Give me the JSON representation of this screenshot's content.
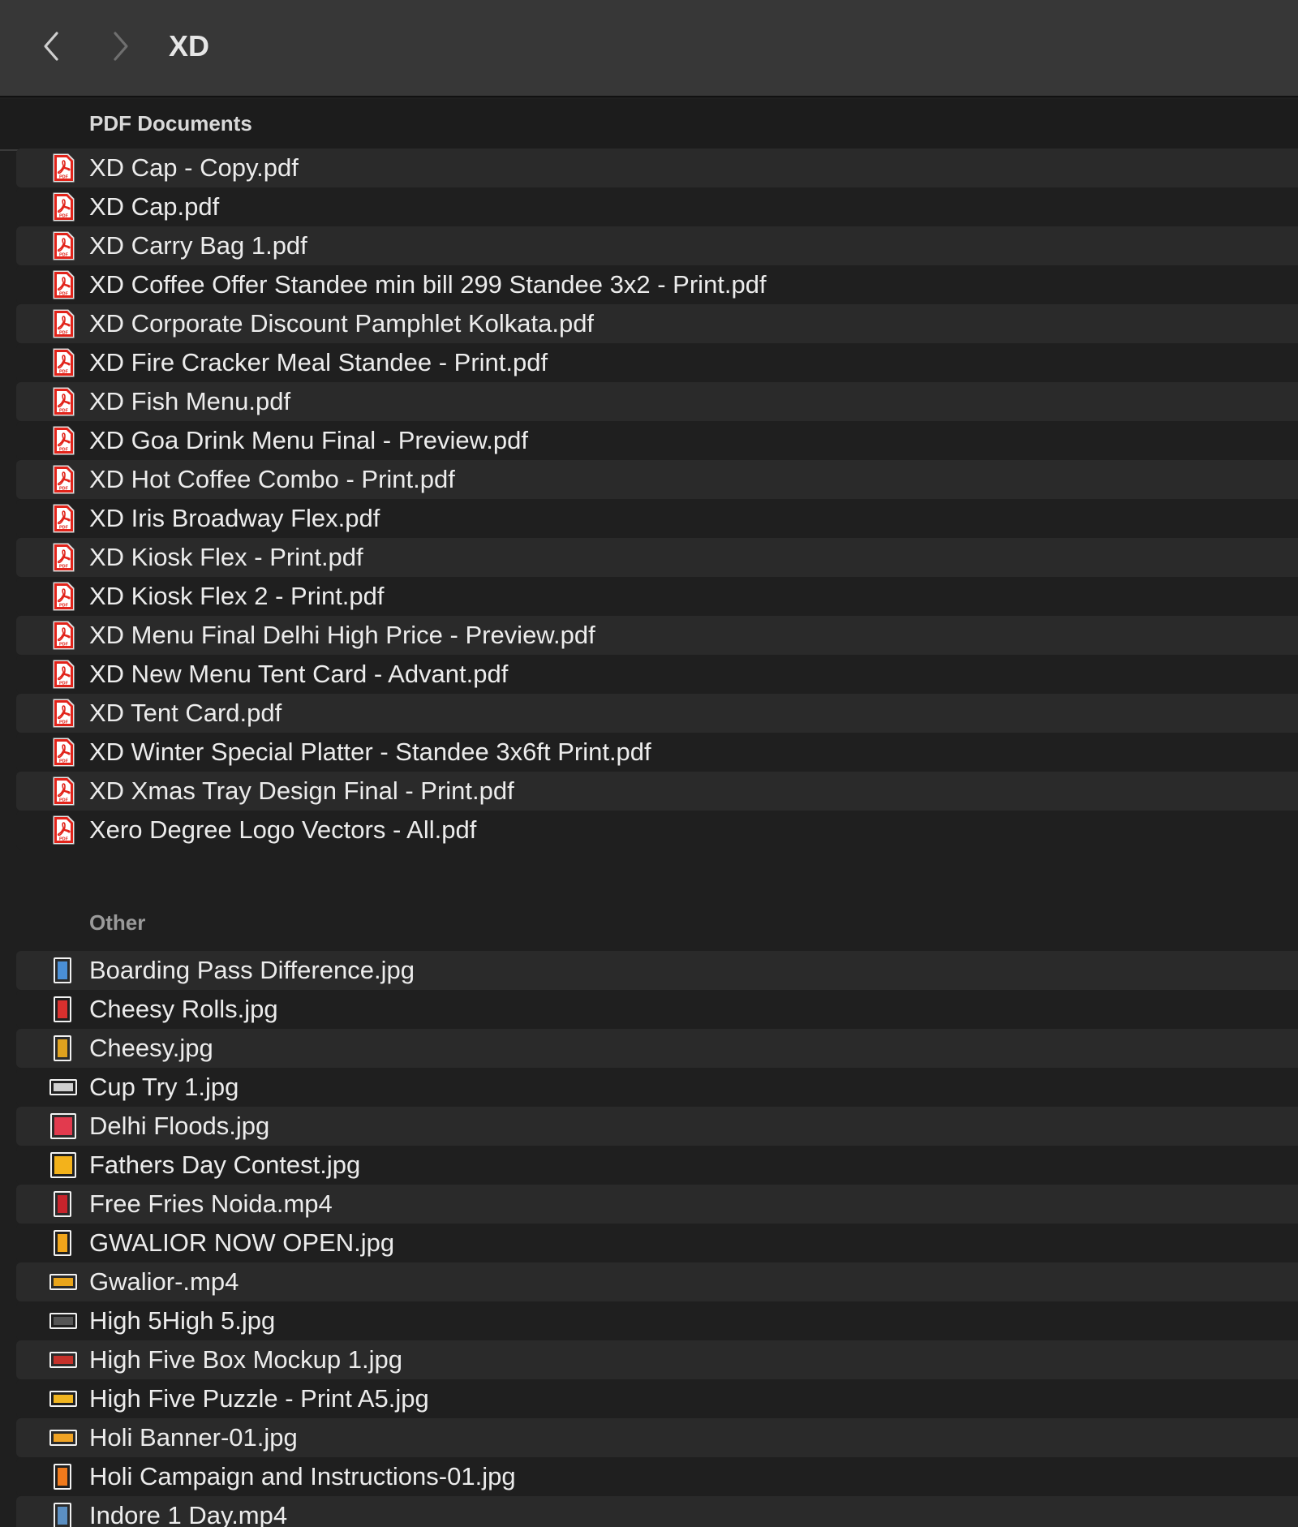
{
  "window": {
    "title": "XD"
  },
  "toolbar": {
    "back_icon": "chevron-left-icon",
    "forward_icon": "chevron-right-icon"
  },
  "sections": {
    "pdf": {
      "header": "PDF Documents",
      "items": [
        {
          "name": "XD Cap - Copy.pdf"
        },
        {
          "name": "XD Cap.pdf"
        },
        {
          "name": "XD Carry Bag 1.pdf"
        },
        {
          "name": "XD Coffee Offer Standee min bill 299 Standee 3x2 - Print.pdf"
        },
        {
          "name": "XD Corporate Discount Pamphlet Kolkata.pdf"
        },
        {
          "name": "XD Fire Cracker Meal Standee - Print.pdf"
        },
        {
          "name": "XD Fish Menu.pdf"
        },
        {
          "name": "XD Goa Drink Menu Final - Preview.pdf"
        },
        {
          "name": "XD Hot Coffee Combo - Print.pdf"
        },
        {
          "name": "XD Iris Broadway Flex.pdf"
        },
        {
          "name": "XD Kiosk Flex - Print.pdf"
        },
        {
          "name": "XD Kiosk Flex 2 - Print.pdf"
        },
        {
          "name": "XD Menu Final Delhi High Price - Preview.pdf"
        },
        {
          "name": "XD New Menu Tent Card - Advant.pdf"
        },
        {
          "name": "XD Tent Card.pdf"
        },
        {
          "name": "XD Winter Special Platter - Standee 3x6ft Print.pdf"
        },
        {
          "name": "XD Xmas Tray Design Final - Print.pdf"
        },
        {
          "name": "Xero Degree Logo Vectors - All.pdf"
        }
      ]
    },
    "other": {
      "header": "Other",
      "items": [
        {
          "name": "Boarding Pass Difference.jpg",
          "icon": "image-thumbnail-icon",
          "shape": "portrait",
          "color": "#4a8fd6"
        },
        {
          "name": "Cheesy Rolls.jpg",
          "icon": "image-thumbnail-icon",
          "shape": "portrait",
          "color": "#d8302e"
        },
        {
          "name": "Cheesy.jpg",
          "icon": "image-thumbnail-icon",
          "shape": "portrait",
          "color": "#e0a21e"
        },
        {
          "name": "Cup Try 1.jpg",
          "icon": "image-thumbnail-icon",
          "shape": "landscape",
          "color": "#cfcfcf"
        },
        {
          "name": "Delhi Floods.jpg",
          "icon": "image-thumbnail-icon",
          "shape": "square",
          "color": "#e23a4e"
        },
        {
          "name": "Fathers Day Contest.jpg",
          "icon": "image-thumbnail-icon",
          "shape": "square",
          "color": "#f3b21b"
        },
        {
          "name": "Free Fries Noida.mp4",
          "icon": "video-thumbnail-icon",
          "shape": "portrait",
          "color": "#c8242c"
        },
        {
          "name": "GWALIOR NOW OPEN.jpg",
          "icon": "image-thumbnail-icon",
          "shape": "portrait",
          "color": "#f0a51a"
        },
        {
          "name": "Gwalior-.mp4",
          "icon": "video-thumbnail-icon",
          "shape": "landscape",
          "color": "#e9a51b"
        },
        {
          "name": "High 5High 5.jpg",
          "icon": "image-thumbnail-icon",
          "shape": "landscape",
          "color": "#555555"
        },
        {
          "name": "High Five Box Mockup 1.jpg",
          "icon": "image-thumbnail-icon",
          "shape": "landscape",
          "color": "#c5312a"
        },
        {
          "name": "High Five Puzzle - Print A5.jpg",
          "icon": "image-thumbnail-icon",
          "shape": "landscape",
          "color": "#f1b520"
        },
        {
          "name": "Holi Banner-01.jpg",
          "icon": "image-thumbnail-icon",
          "shape": "landscape",
          "color": "#f0a324"
        },
        {
          "name": "Holi Campaign and Instructions-01.jpg",
          "icon": "image-thumbnail-icon",
          "shape": "portrait",
          "color": "#f07a1c"
        },
        {
          "name": "Indore 1 Day.mp4",
          "icon": "video-thumbnail-icon",
          "shape": "portrait",
          "color": "#5b8fc2"
        }
      ]
    }
  },
  "colors": {
    "toolbar_bg": "#373737",
    "list_bg": "#1f1f1f",
    "row_stripe": "#2a2a2a",
    "pdf_red": "#e2231a"
  }
}
